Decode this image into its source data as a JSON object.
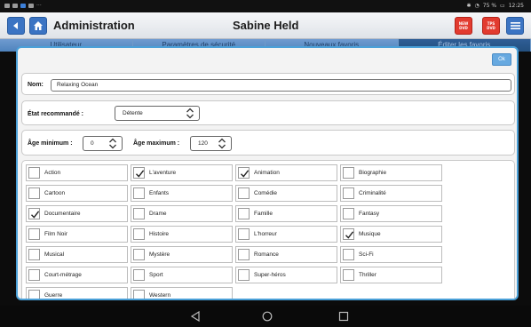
{
  "header": {
    "title": "Administration",
    "user": "Sabine Held",
    "icon_buttons": [
      "back-icon",
      "home-icon",
      "menu-icon"
    ],
    "red_buttons": [
      {
        "top": "NEW",
        "bottom": "DVD"
      },
      {
        "top": "TPS",
        "bottom": "DVD"
      }
    ]
  },
  "status": {
    "battery": "75 %",
    "time": "12:25"
  },
  "tabs": [
    {
      "label": "Utilisateur",
      "active": false
    },
    {
      "label": "Paramètres de sécurité",
      "active": false
    },
    {
      "label": "Nouveaux favoris",
      "active": false
    },
    {
      "label": "Éditer les favoris",
      "active": true
    }
  ],
  "dialog": {
    "ok_label": "Ok",
    "name_label": "Nom:",
    "name_value": "Relaxing Ocean",
    "state_label": "État recommandé :",
    "state_value": "Détente",
    "min_age_label": "Âge minimum :",
    "min_age_value": "0",
    "max_age_label": "Âge maximum :",
    "max_age_value": "120"
  },
  "genres": [
    {
      "label": "Action",
      "checked": false
    },
    {
      "label": "L'aventure",
      "checked": true
    },
    {
      "label": "Animation",
      "checked": true
    },
    {
      "label": "Biographie",
      "checked": false
    },
    {
      "label": "Cartoon",
      "checked": false
    },
    {
      "label": "Enfants",
      "checked": false
    },
    {
      "label": "Comédie",
      "checked": false
    },
    {
      "label": "Criminalité",
      "checked": false
    },
    {
      "label": "Documentaire",
      "checked": true
    },
    {
      "label": "Drame",
      "checked": false
    },
    {
      "label": "Famille",
      "checked": false
    },
    {
      "label": "Fantasy",
      "checked": false
    },
    {
      "label": "Film Noir",
      "checked": false
    },
    {
      "label": "Histoire",
      "checked": false
    },
    {
      "label": "L'horreur",
      "checked": false
    },
    {
      "label": "Musique",
      "checked": true
    },
    {
      "label": "Musical",
      "checked": false
    },
    {
      "label": "Mystère",
      "checked": false
    },
    {
      "label": "Romance",
      "checked": false
    },
    {
      "label": "Sci-Fi",
      "checked": false
    },
    {
      "label": "Court-métrage",
      "checked": false
    },
    {
      "label": "Sport",
      "checked": false
    },
    {
      "label": "Super-héros",
      "checked": false
    },
    {
      "label": "Thriller",
      "checked": false
    },
    {
      "label": "Guerre",
      "checked": false
    },
    {
      "label": "Western",
      "checked": false
    }
  ],
  "navbar": {
    "icons": [
      "back-triangle-icon",
      "home-circle-icon",
      "recents-square-icon"
    ]
  },
  "colors": {
    "header_blue": "#3b74c3",
    "tab_active": "#23507f",
    "dialog_border": "#4aa0d8",
    "red_button": "#e23b2f"
  }
}
